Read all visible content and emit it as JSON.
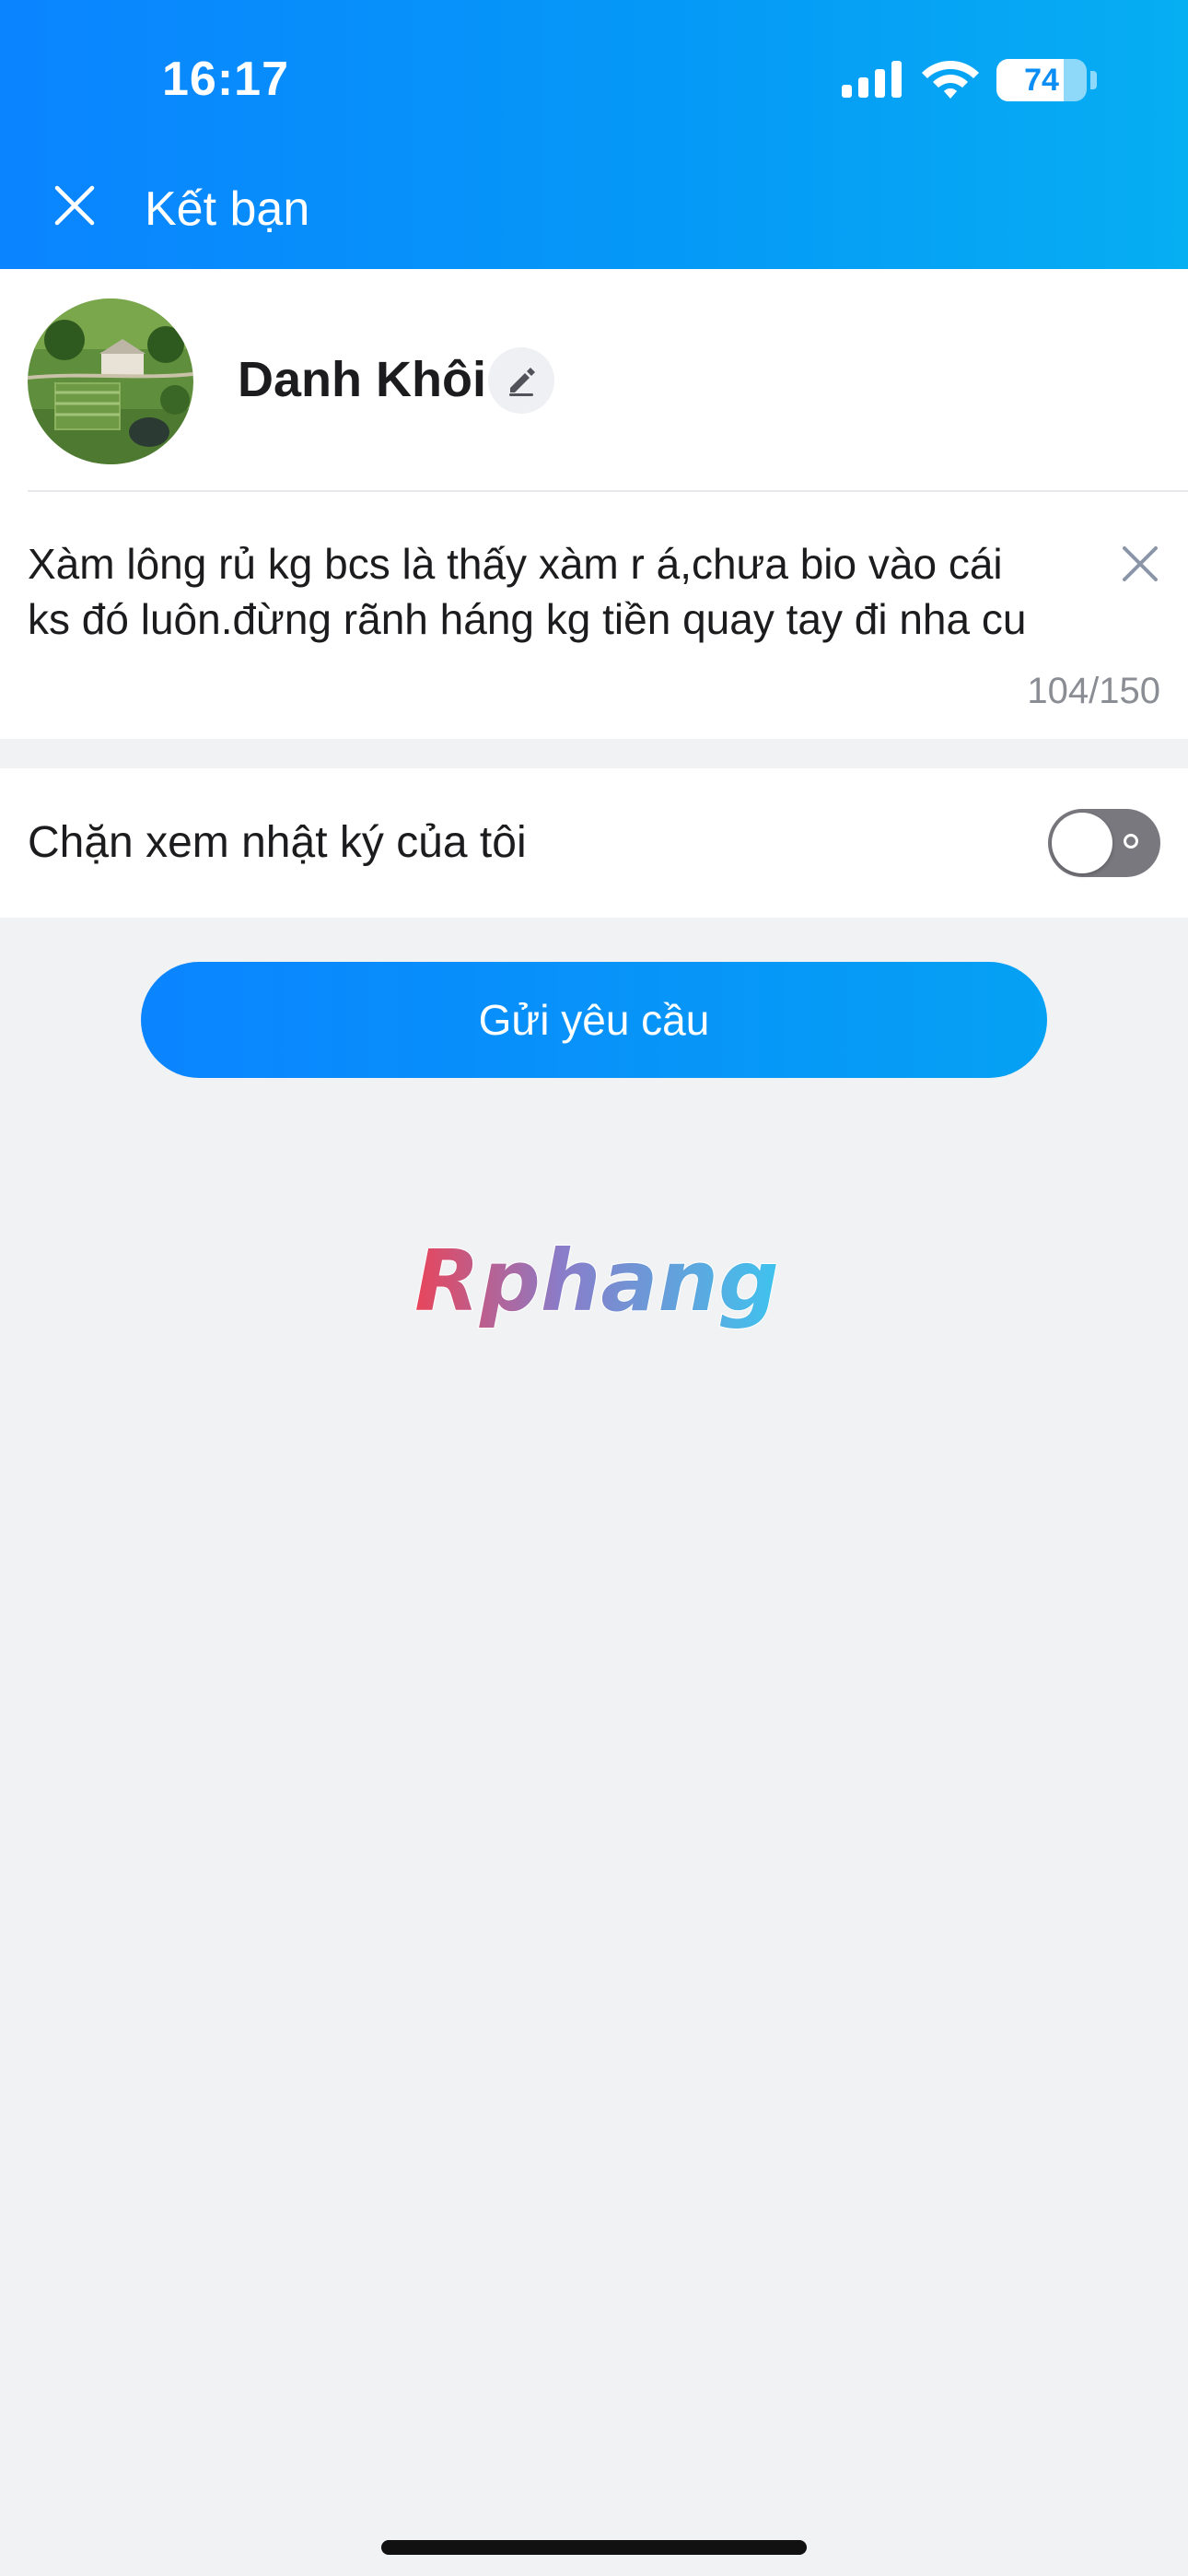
{
  "status_bar": {
    "time": "16:17",
    "battery_level": "74",
    "battery_fraction": 0.74
  },
  "nav": {
    "title": "Kết bạn",
    "close_icon": "close-icon"
  },
  "profile": {
    "name": "Danh Khôi",
    "edit_icon": "pencil-icon"
  },
  "message": {
    "text": "Xàm lông rủ kg bcs là thấy xàm r á,chưa bio vào cái\nks đó luôn.đừng rãnh háng kg tiền quay tay đi nha cu",
    "counter": "104/150",
    "clear_icon": "close-icon"
  },
  "privacy": {
    "label": "Chặn xem nhật ký của tôi",
    "enabled": false
  },
  "actions": {
    "send_label": "Gửi yêu cầu"
  },
  "watermark": {
    "text": "Rphang"
  },
  "colors": {
    "accent": "#0a84ff",
    "header_end": "#06aef2",
    "background": "#f1f2f4",
    "toggle_off": "#78787e"
  }
}
